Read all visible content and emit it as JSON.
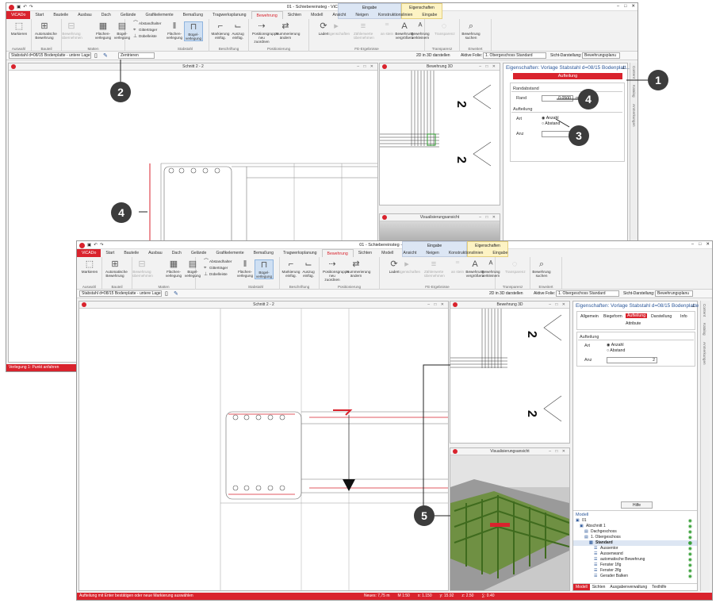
{
  "back": {
    "title": "01 - Schiebereinsteg - ViCADo 2020",
    "ctx": {
      "eingabe": "Eingabe",
      "eigenschaften": "Eigenschaften"
    },
    "tabs": [
      "ViCADo",
      "Start",
      "Bauteile",
      "Ausbau",
      "Dach",
      "Gelände",
      "Grafikelemente",
      "Bemaßung",
      "Tragwerksplanung",
      "Bewehrung",
      "Sichten",
      "Modell",
      "Ansicht",
      "Neigen",
      "Konstruktionslinien",
      "Eingabe"
    ],
    "ribbon": {
      "buttons": [
        "Markieren",
        "Automatische Bewehrung",
        "Bewehrung übernehmen",
        "Flächen-verlegung",
        "Bügel-verlegung",
        "Abstandhalter",
        "Gitterträger",
        "Dübelleiste",
        "Flächen-verlegung",
        "Bügel-verlegung",
        "Markierung einfüg.",
        "Auszug einfüg.",
        "Positionsgruppe neu zuordnen",
        "Nummerierung ändern",
        "Laden",
        "Eigenschaften",
        "Zählerwerte übernehmen",
        "an stein",
        "Bewehrung vergrößern",
        "Bewehrung verkleinern",
        "Transparenz",
        "Bewehrung suchen"
      ],
      "groups": [
        "Auswahl",
        "Bauteil",
        "Matten",
        "Stabstahl",
        "Beschriftung",
        "Positionierung",
        "FE-Ergebnisse",
        "Transparenz",
        "Erweitert"
      ]
    },
    "toolbar": {
      "layer": "Stabstahl d=08/15 Bodenplatte - untere Lage",
      "mode": "Zentrieren",
      "view3d": "2D in 3D darstellen",
      "folie_label": "Aktive Folie:",
      "folie": "1. Obergeschoss  Standard",
      "sicht_label": "Sicht-Darstellung:",
      "sicht": "Bewehrungsplanu"
    },
    "panes": {
      "schnitt": "Schnitt 2 - 2",
      "bew": "Bewehrung 3D",
      "vis": "Visualisierungsansicht"
    },
    "prop": {
      "title": "Eigenschaften: Vorlage Stabstahl d=08/15 Bodenplatt...",
      "section": "Aufteilung",
      "randabstand": "Randabstand",
      "rand_label": "Rand",
      "rand_value": "0.0500",
      "rand_unit": "m",
      "aufteilung": "Aufteilung",
      "art_label": "Art",
      "art_opt1": "Anzahl",
      "art_opt2": "Abstand",
      "anz_label": "Anz",
      "anz_value": "2"
    },
    "side": [
      "Content",
      "Katalog",
      "Anmerkungen"
    ],
    "status": "Verlegung 1: Punkt anfahren"
  },
  "front": {
    "title": "01 - Schiebereinsteg - ViCADo 2020",
    "ctx": {
      "eingabe": "Eingabe",
      "eigenschaften": "Eigenschaften"
    },
    "tabs": [
      "ViCADo",
      "Start",
      "Bauteile",
      "Ausbau",
      "Dach",
      "Gelände",
      "Grafikelemente",
      "Bemaßung",
      "Tragwerksplanung",
      "Bewehrung",
      "Sichten",
      "Modell",
      "Ansicht",
      "Neigen",
      "Konstruktionslinien",
      "Eingabe"
    ],
    "toolbar": {
      "layer": "Stabstahl d=08/15 Bodenplatte - untere Lage",
      "view3d": "2D in 3D darstellen",
      "folie_label": "Aktive Folie:",
      "folie": "1. Obergeschoss  Standard",
      "sicht_label": "Sicht-Darstellung:",
      "sicht": "Bewehrungsplanu"
    },
    "panes": {
      "schnitt": "Schnitt 2 - 2",
      "bew": "Bewehrung 3D",
      "vis": "Visualisierungsansicht"
    },
    "prop": {
      "title": "Eigenschaften: Vorlage Stabstahl d=08/15 Bodenplatte ...",
      "tabs": [
        "Allgemein",
        "Biegeform",
        "Aufteilung",
        "Darstellung",
        "Info"
      ],
      "subtab": "Attribute",
      "section": "Aufteilung",
      "art_label": "Art",
      "art_opt1": "Anzahl",
      "art_opt2": "Abstand",
      "anz_label": "Anz",
      "anz_value": "2",
      "hilfe": "Hilfe"
    },
    "model": {
      "header": "Modell",
      "rows": [
        "01",
        "Abschnitt 1",
        "Dachgeschoss",
        "1. Obergeschoss",
        "Standard",
        "Aussentor",
        "Aussenwand",
        "automatische Bewehrung",
        "Fenster 1flg",
        "Fenster 2flg",
        "Gerader Balken"
      ],
      "tabs": [
        "Modell",
        "Sichten",
        "Ausgabenverwaltung",
        "Texthilfe"
      ]
    },
    "side": [
      "Content",
      "Katalog",
      "Anmerkungen"
    ],
    "status": "Aufteilung mit Enter bestätigen oder neue Markierung auswählen",
    "status_right": [
      "Neues: 7,75 m",
      "M 1:50",
      "x: 1.150",
      "y: 15.92",
      "z: 2.50",
      "∑: 0.40"
    ]
  },
  "callouts": [
    "1",
    "2",
    "3",
    "4",
    "4",
    "5"
  ],
  "colors": {
    "accent": "#d9232d",
    "ribbon_sel": "#cfe0f3",
    "ctx_blue": "#dce6f4",
    "ctx_yellow": "#fdf3c4"
  }
}
